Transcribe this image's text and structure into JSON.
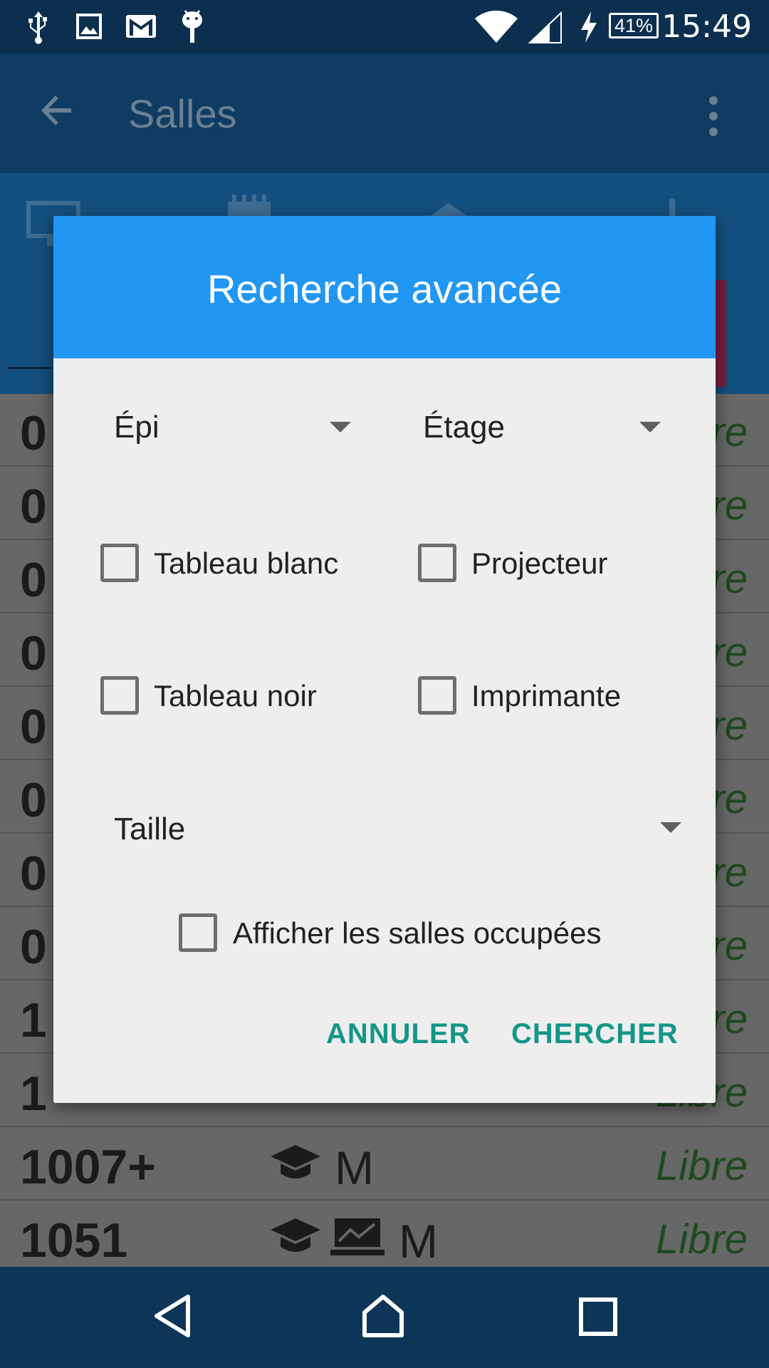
{
  "status_bar": {
    "time": "15:49",
    "battery_percent": "41%",
    "left_icons": [
      "usb-icon",
      "image-icon",
      "gmail-icon",
      "android-debug-icon"
    ],
    "right_icons": [
      "wifi-icon",
      "signal-icon",
      "charging-icon"
    ]
  },
  "app_bar": {
    "title": "Salles"
  },
  "list": {
    "rows": [
      {
        "number": "0",
        "status": "re"
      },
      {
        "number": "0",
        "status": "re"
      },
      {
        "number": "0",
        "status": "re"
      },
      {
        "number": "0",
        "status": "re"
      },
      {
        "number": "0",
        "status": "re"
      },
      {
        "number": "0",
        "status": "re"
      },
      {
        "number": "0",
        "status": "re"
      },
      {
        "number": "0",
        "status": "re"
      },
      {
        "number": "1",
        "status": "re"
      },
      {
        "number": "1",
        "status": "Libre"
      },
      {
        "number": "1007+",
        "size": "M",
        "status": "Libre"
      },
      {
        "number": "1051",
        "size": "M",
        "status": "Libre"
      }
    ]
  },
  "dialog": {
    "title": "Recherche avancée",
    "spinner_epi": "Épi",
    "spinner_etage": "Étage",
    "checkbox_tableau_blanc": "Tableau blanc",
    "checkbox_projecteur": "Projecteur",
    "checkbox_tableau_noir": "Tableau noir",
    "checkbox_imprimante": "Imprimante",
    "spinner_taille": "Taille",
    "checkbox_occupees": "Afficher les salles occupées",
    "cancel_label": "ANNULER",
    "search_label": "CHERCHER"
  },
  "colors": {
    "dialog_header": "#2196f3",
    "button_text": "#149688",
    "status_libre": "#1d4a1d"
  }
}
